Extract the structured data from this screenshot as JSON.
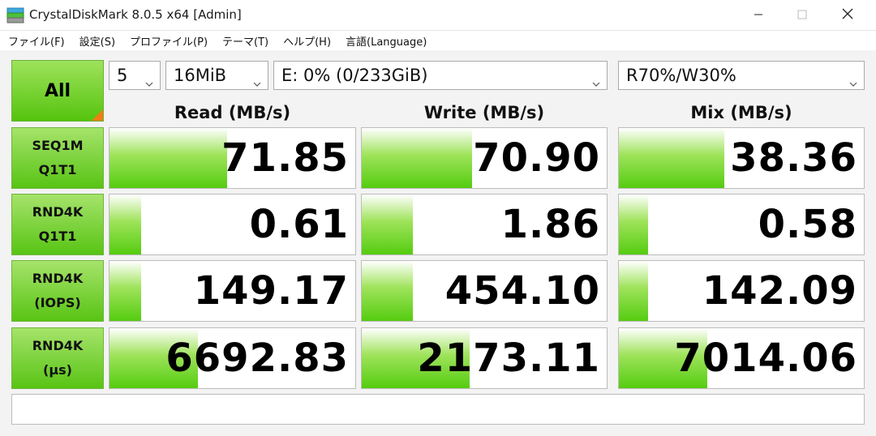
{
  "window": {
    "title": "CrystalDiskMark 8.0.5 x64 [Admin]"
  },
  "menu": [
    "ファイル(F)",
    "設定(S)",
    "プロファイル(P)",
    "テーマ(T)",
    "ヘルプ(H)",
    "言語(Language)"
  ],
  "controls": {
    "all_label": "All",
    "count": "5",
    "size": "16MiB",
    "drive": "E: 0% (0/233GiB)",
    "mix": "R70%/W30%"
  },
  "headers": {
    "read": "Read (MB/s)",
    "write": "Write (MB/s)",
    "mix": "Mix (MB/s)"
  },
  "rows": [
    {
      "line1": "SEQ1M",
      "line2": "Q1T1",
      "read": "71.85",
      "write": "70.90",
      "mix": "38.36",
      "read_fill": 0.48,
      "write_fill": 0.45,
      "mix_fill": 0.43
    },
    {
      "line1": "RND4K",
      "line2": "Q1T1",
      "read": "0.61",
      "write": "1.86",
      "mix": "0.58",
      "read_fill": 0.13,
      "write_fill": 0.21,
      "mix_fill": 0.12
    },
    {
      "line1": "RND4K",
      "line2": "(IOPS)",
      "read": "149.17",
      "write": "454.10",
      "mix": "142.09",
      "read_fill": 0.13,
      "write_fill": 0.21,
      "mix_fill": 0.12
    },
    {
      "line1": "RND4K",
      "line2": "(μs)",
      "read": "6692.83",
      "write": "2173.11",
      "mix": "7014.06",
      "read_fill": 0.36,
      "write_fill": 0.44,
      "mix_fill": 0.36
    }
  ],
  "status": "",
  "colors": {
    "accent_green": "#55c40e",
    "corner_orange": "#f07c16"
  }
}
